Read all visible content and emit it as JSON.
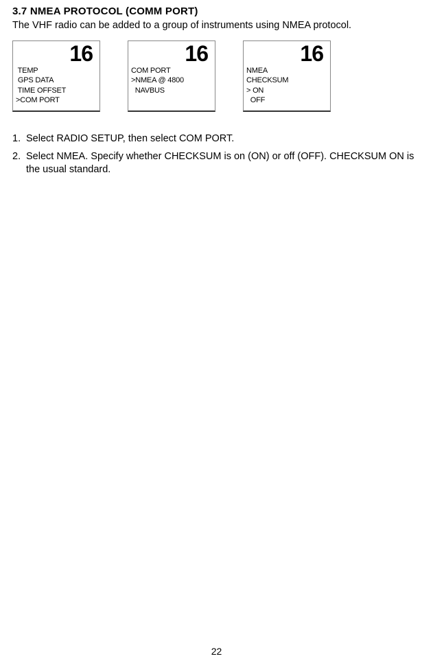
{
  "heading": "3.7 NMEA PROTOCOL (COMM PORT)",
  "intro": "The VHF radio can be added to a group of instruments using NMEA protocol.",
  "screens": [
    {
      "channel": "16",
      "lines": [
        " TEMP",
        " GPS DATA",
        " TIME OFFSET",
        ">COM PORT"
      ]
    },
    {
      "channel": "16",
      "lines": [
        "COM PORT",
        ">NMEA @ 4800",
        "  NAVBUS"
      ]
    },
    {
      "channel": "16",
      "lines": [
        "NMEA",
        "CHECKSUM",
        "> ON",
        "  OFF"
      ]
    }
  ],
  "steps": [
    {
      "num": "1.",
      "text": "Select RADIO SETUP, then select COM PORT."
    },
    {
      "num": "2.",
      "text": "Select NMEA. Specify whether CHECKSUM is on (ON) or off (OFF). CHECKSUM ON is the usual standard."
    }
  ],
  "page_number": "22"
}
